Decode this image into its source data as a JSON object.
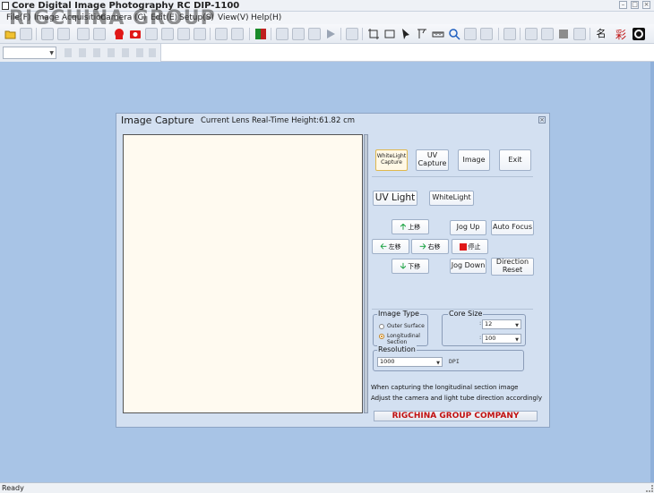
{
  "window": {
    "title": "Core Digital Image Photography RC DIP-1100",
    "watermark": "RIGCHINA GROUP"
  },
  "menu": {
    "items": [
      "File(F)",
      "Image Acquisition",
      "Camera",
      "(C)",
      "Edit(E)",
      "Setup(S)",
      "View(V)",
      "Help(H)"
    ]
  },
  "toolbar": {
    "icons": [
      "open-folder-icon",
      "save-icon",
      "red-camera-icon",
      "red-photo-icon",
      "camera-icon",
      "image-icon",
      "zoom-icon",
      "pointer-icon",
      "ruler-icon",
      "search-icon",
      "rectangle-icon",
      "text-icon",
      "calligraphy-icon",
      "settings-icon"
    ],
    "text_icon_label": "名"
  },
  "dialog": {
    "title": "Image Capture",
    "height_label": "Current Lens Real-Time Height:61.82 cm",
    "buttons": {
      "whitelight_capture": "WhiteLight Capture",
      "uv_capture": "UV Capture",
      "image": "Image",
      "exit": "Exit",
      "uv_light": "UV Light",
      "whitelight": "WhiteLight",
      "move_up": "上移",
      "move_left": "左移",
      "move_right": "右移",
      "move_down": "下移",
      "stop": "停止",
      "jog_up": "Jog Up",
      "jog_down": "Jog Down",
      "auto_focus": "Auto Focus",
      "direction_reset": "Direction Reset"
    },
    "image_type": {
      "label": "Image Type",
      "options": [
        "Outer Surface",
        "Longitudinal Section"
      ],
      "selected": "Longitudinal Section"
    },
    "core_size": {
      "label": "Core Size",
      "value1": "12",
      "value2": "100"
    },
    "resolution": {
      "label": "Resolution",
      "value": "1000",
      "unit": "DPI"
    },
    "notes": [
      "When capturing the longitudinal section image",
      "Adjust the camera and light tube direction accordingly"
    ],
    "brand": "RIGCHINA GROUP COMPANY"
  },
  "status": {
    "text": "Ready"
  },
  "colors": {
    "background": "#a8c4e6",
    "dialog": "#d3e0f1",
    "preview": "#fffaf0",
    "brand_text": "#c01010",
    "arrow_green": "#12a03a",
    "stop_red": "#e01818"
  }
}
